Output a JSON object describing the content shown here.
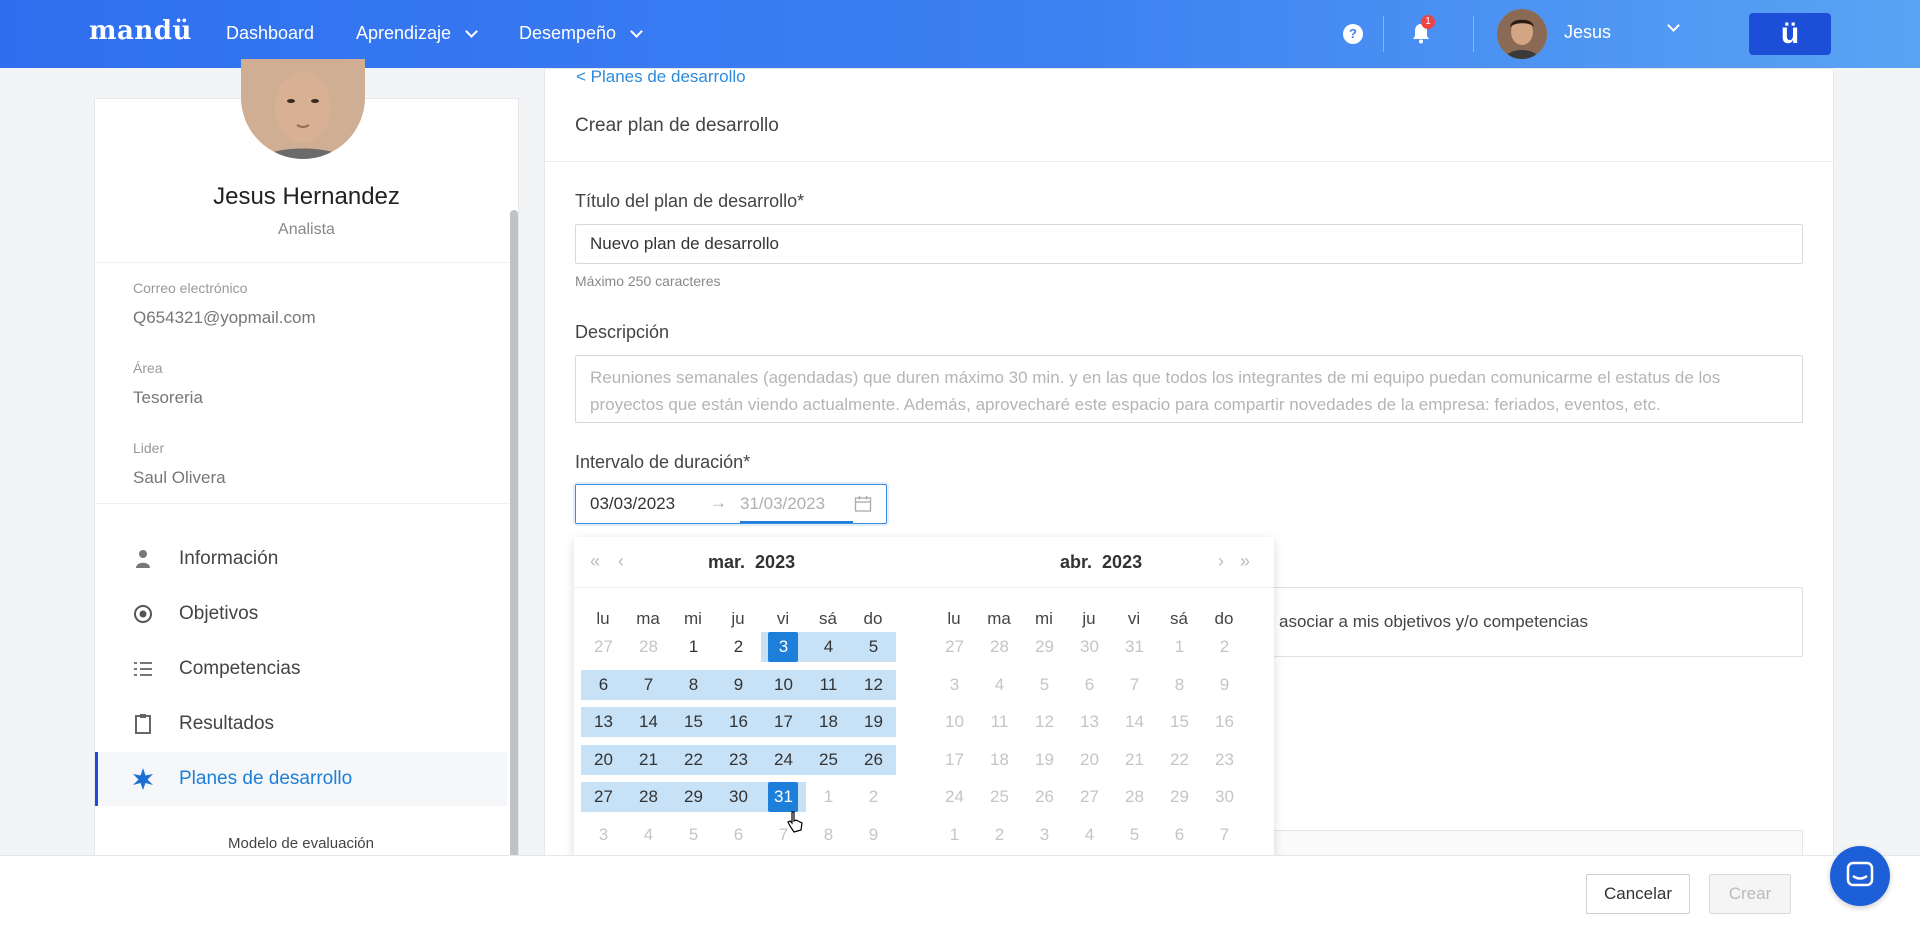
{
  "topbar": {
    "logo": "mandü",
    "nav": [
      {
        "label": "Dashboard"
      },
      {
        "label": "Aprendizaje"
      },
      {
        "label": "Desempeño"
      }
    ],
    "help_icon": "question-circle-icon",
    "notifications_count": "1",
    "user_name": "Jesus",
    "brand_button": "ü"
  },
  "profile": {
    "name": "Jesus Hernandez",
    "role": "Analista",
    "email_label": "Correo electrónico",
    "email": "Q654321@yopmail.com",
    "area_label": "Área",
    "area": "Tesoreria",
    "leader_label": "Lider",
    "leader": "Saul Olivera",
    "menu": [
      {
        "label": "Información",
        "icon": "person-icon"
      },
      {
        "label": "Objetivos",
        "icon": "target-icon"
      },
      {
        "label": "Competencias",
        "icon": "list-icon"
      },
      {
        "label": "Resultados",
        "icon": "clipboard-icon"
      },
      {
        "label": "Planes de desarrollo",
        "icon": "star-burst-icon",
        "active": true
      }
    ],
    "model_label": "Modelo de evaluación"
  },
  "form": {
    "back_link": "< Planes de desarrollo",
    "page_title": "Crear plan de desarrollo",
    "title_label": "Título del plan de desarrollo*",
    "title_value": "Nuevo plan de desarrollo",
    "title_helper": "Máximo 250 caracteres",
    "description_label": "Descripción",
    "description_placeholder": "Reuniones semanales (agendadas) que duren máximo 30 min. y en las que todos los integrantes de mi equipo puedan comunicarme el estatus de los proyectos que están viendo actualmente. Además, aprovecharé este espacio para compartir novedades de la empresa: feriados, eventos, etc.",
    "duration_label": "Intervalo de duración*",
    "range_start": "03/03/2023",
    "range_arrow": "→",
    "range_end": "31/03/2023",
    "associate_text": "asociar a mis objetivos y/o competencias"
  },
  "calendar": {
    "nav_prev_year": "«",
    "nav_prev_month": "‹",
    "nav_next_month": "›",
    "nav_next_year": "»",
    "left": {
      "month": "mar.",
      "year": "2023",
      "weekdays": [
        "lu",
        "ma",
        "mi",
        "ju",
        "vi",
        "sá",
        "do"
      ],
      "weeks": [
        [
          "27",
          "28",
          "1",
          "2",
          "3",
          "4",
          "5"
        ],
        [
          "6",
          "7",
          "8",
          "9",
          "10",
          "11",
          "12"
        ],
        [
          "13",
          "14",
          "15",
          "16",
          "17",
          "18",
          "19"
        ],
        [
          "20",
          "21",
          "22",
          "23",
          "24",
          "25",
          "26"
        ],
        [
          "27",
          "28",
          "29",
          "30",
          "31",
          "1",
          "2"
        ],
        [
          "3",
          "4",
          "5",
          "6",
          "7",
          "8",
          "9"
        ]
      ]
    },
    "right": {
      "month": "abr.",
      "year": "2023",
      "weekdays": [
        "lu",
        "ma",
        "mi",
        "ju",
        "vi",
        "sá",
        "do"
      ],
      "weeks": [
        [
          "27",
          "28",
          "29",
          "30",
          "31",
          "1",
          "2"
        ],
        [
          "3",
          "4",
          "5",
          "6",
          "7",
          "8",
          "9"
        ],
        [
          "10",
          "11",
          "12",
          "13",
          "14",
          "15",
          "16"
        ],
        [
          "17",
          "18",
          "19",
          "20",
          "21",
          "22",
          "23"
        ],
        [
          "24",
          "25",
          "26",
          "27",
          "28",
          "29",
          "30"
        ],
        [
          "1",
          "2",
          "3",
          "4",
          "5",
          "6",
          "7"
        ]
      ]
    },
    "range_start_day": "3",
    "range_end_day": "31"
  },
  "footer": {
    "cancel_label": "Cancelar",
    "create_label": "Crear",
    "chat_icon": "chat-bubble-icon"
  },
  "colors": {
    "accent": "#1d7fd9",
    "range": "#c7e1f7",
    "topbar_start": "#2f6fef",
    "topbar_end": "#5aa3f3"
  }
}
